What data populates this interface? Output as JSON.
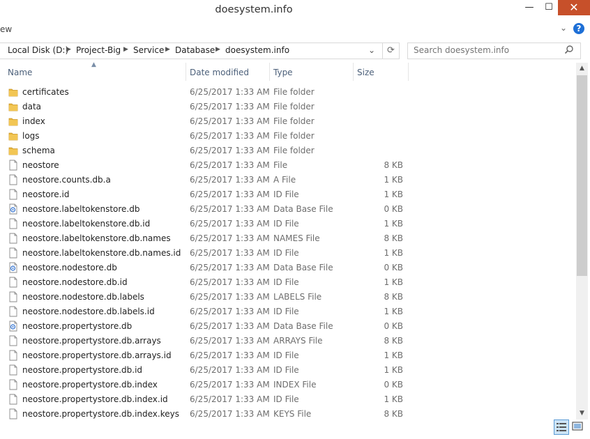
{
  "window": {
    "title": "doesystem.info",
    "min_glyph": "—",
    "max_glyph": "☐",
    "close_glyph": "✕"
  },
  "ribbon": {
    "partial_text": "ew"
  },
  "address": {
    "crumbs": [
      "Local Disk (D:)",
      "Project-Big",
      "Service",
      "Database",
      "doesystem.info"
    ],
    "separator": "▶"
  },
  "search": {
    "placeholder": "Search doesystem.info"
  },
  "columns": {
    "name": "Name",
    "date": "Date modified",
    "type": "Type",
    "size": "Size"
  },
  "files": [
    {
      "name": "certificates",
      "date": "6/25/2017 1:33 AM",
      "type": "File folder",
      "size": "",
      "icon": "folder-icon"
    },
    {
      "name": "data",
      "date": "6/25/2017 1:33 AM",
      "type": "File folder",
      "size": "",
      "icon": "folder-icon"
    },
    {
      "name": "index",
      "date": "6/25/2017 1:33 AM",
      "type": "File folder",
      "size": "",
      "icon": "folder-icon"
    },
    {
      "name": "logs",
      "date": "6/25/2017 1:33 AM",
      "type": "File folder",
      "size": "",
      "icon": "folder-icon"
    },
    {
      "name": "schema",
      "date": "6/25/2017 1:33 AM",
      "type": "File folder",
      "size": "",
      "icon": "folder-icon"
    },
    {
      "name": "neostore",
      "date": "6/25/2017 1:33 AM",
      "type": "File",
      "size": "8 KB",
      "icon": "file-icon"
    },
    {
      "name": "neostore.counts.db.a",
      "date": "6/25/2017 1:33 AM",
      "type": "A File",
      "size": "1 KB",
      "icon": "file-icon"
    },
    {
      "name": "neostore.id",
      "date": "6/25/2017 1:33 AM",
      "type": "ID File",
      "size": "1 KB",
      "icon": "file-icon"
    },
    {
      "name": "neostore.labeltokenstore.db",
      "date": "6/25/2017 1:33 AM",
      "type": "Data Base File",
      "size": "0 KB",
      "icon": "database-file-icon"
    },
    {
      "name": "neostore.labeltokenstore.db.id",
      "date": "6/25/2017 1:33 AM",
      "type": "ID File",
      "size": "1 KB",
      "icon": "file-icon"
    },
    {
      "name": "neostore.labeltokenstore.db.names",
      "date": "6/25/2017 1:33 AM",
      "type": "NAMES File",
      "size": "8 KB",
      "icon": "file-icon"
    },
    {
      "name": "neostore.labeltokenstore.db.names.id",
      "date": "6/25/2017 1:33 AM",
      "type": "ID File",
      "size": "1 KB",
      "icon": "file-icon"
    },
    {
      "name": "neostore.nodestore.db",
      "date": "6/25/2017 1:33 AM",
      "type": "Data Base File",
      "size": "0 KB",
      "icon": "database-file-icon"
    },
    {
      "name": "neostore.nodestore.db.id",
      "date": "6/25/2017 1:33 AM",
      "type": "ID File",
      "size": "1 KB",
      "icon": "file-icon"
    },
    {
      "name": "neostore.nodestore.db.labels",
      "date": "6/25/2017 1:33 AM",
      "type": "LABELS File",
      "size": "8 KB",
      "icon": "file-icon"
    },
    {
      "name": "neostore.nodestore.db.labels.id",
      "date": "6/25/2017 1:33 AM",
      "type": "ID File",
      "size": "1 KB",
      "icon": "file-icon"
    },
    {
      "name": "neostore.propertystore.db",
      "date": "6/25/2017 1:33 AM",
      "type": "Data Base File",
      "size": "0 KB",
      "icon": "database-file-icon"
    },
    {
      "name": "neostore.propertystore.db.arrays",
      "date": "6/25/2017 1:33 AM",
      "type": "ARRAYS File",
      "size": "8 KB",
      "icon": "file-icon"
    },
    {
      "name": "neostore.propertystore.db.arrays.id",
      "date": "6/25/2017 1:33 AM",
      "type": "ID File",
      "size": "1 KB",
      "icon": "file-icon"
    },
    {
      "name": "neostore.propertystore.db.id",
      "date": "6/25/2017 1:33 AM",
      "type": "ID File",
      "size": "1 KB",
      "icon": "file-icon"
    },
    {
      "name": "neostore.propertystore.db.index",
      "date": "6/25/2017 1:33 AM",
      "type": "INDEX File",
      "size": "0 KB",
      "icon": "file-icon"
    },
    {
      "name": "neostore.propertystore.db.index.id",
      "date": "6/25/2017 1:33 AM",
      "type": "ID File",
      "size": "1 KB",
      "icon": "file-icon"
    },
    {
      "name": "neostore.propertystore.db.index.keys",
      "date": "6/25/2017 1:33 AM",
      "type": "KEYS File",
      "size": "8 KB",
      "icon": "file-icon"
    }
  ],
  "colors": {
    "folder": "#e8b63a",
    "close_button": "#c7502a",
    "header_text": "#4c607a",
    "accent": "#1e6fd6"
  }
}
